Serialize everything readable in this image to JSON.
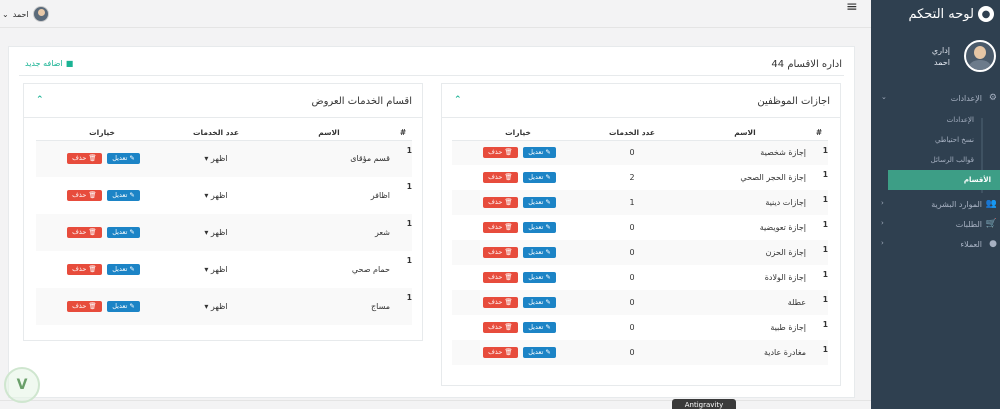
{
  "topbar": {
    "user_name": "احمد",
    "dropdown_glyph": "⌄",
    "hamburger_glyph": "≡"
  },
  "sidebar": {
    "brand": "لوحه التحكم",
    "brand_icon": "paw-icon",
    "profile_role": "إداري",
    "profile_name": "احمد",
    "nav": {
      "settings": "الإعدادات",
      "settings_sub": [
        "الإعدادات",
        "نسخ احتياطي",
        "قوالب الرسائل",
        "الأقسام"
      ],
      "hr": "الموارد البشرية",
      "orders": "الطلبات",
      "clients": "العملاء"
    }
  },
  "page": {
    "title": "اداره الاقسام 44",
    "add_new": "اضافه جديد"
  },
  "employee_leaves": {
    "title": "اجازات الموظفين",
    "headers": {
      "num": "#",
      "name": "الاسم",
      "count": "عدد الخدمات",
      "options": "خيارات"
    },
    "rows": [
      {
        "num": "1",
        "name": "إجازة شخصية",
        "count": "0"
      },
      {
        "num": "1",
        "name": "إجازة الحجر الصحي",
        "count": "2"
      },
      {
        "num": "1",
        "name": "إجازات دينية",
        "count": "1"
      },
      {
        "num": "1",
        "name": "إجازة تعويضية",
        "count": "0"
      },
      {
        "num": "1",
        "name": "إجازة الحزن",
        "count": "0"
      },
      {
        "num": "1",
        "name": "إجازة الولادة",
        "count": "0"
      },
      {
        "num": "1",
        "name": "عطلة",
        "count": "0"
      },
      {
        "num": "1",
        "name": "إجازة طبية",
        "count": "0"
      },
      {
        "num": "1",
        "name": "مغادرة عادية",
        "count": "0"
      }
    ],
    "edit_label": "تعديل",
    "delete_label": "حذف"
  },
  "services_sections": {
    "title": "اقسام الخدمات العروض",
    "headers": {
      "num": "#",
      "name": "الاسم",
      "count": "عدد الخدمات",
      "options": "خيارات"
    },
    "rows": [
      {
        "num": "1",
        "name": "قسم مؤقاى",
        "count": "اظهر"
      },
      {
        "num": "1",
        "name": "اظافر",
        "count": "اظهر"
      },
      {
        "num": "1",
        "name": "شعر",
        "count": "اظهر"
      },
      {
        "num": "1",
        "name": "حمام صحي",
        "count": "اظهر"
      },
      {
        "num": "1",
        "name": "مساج",
        "count": "اظهر"
      }
    ],
    "edit_label": "تعديل",
    "delete_label": "حذف"
  },
  "overlay": {
    "antigravity": "Antigravity"
  }
}
